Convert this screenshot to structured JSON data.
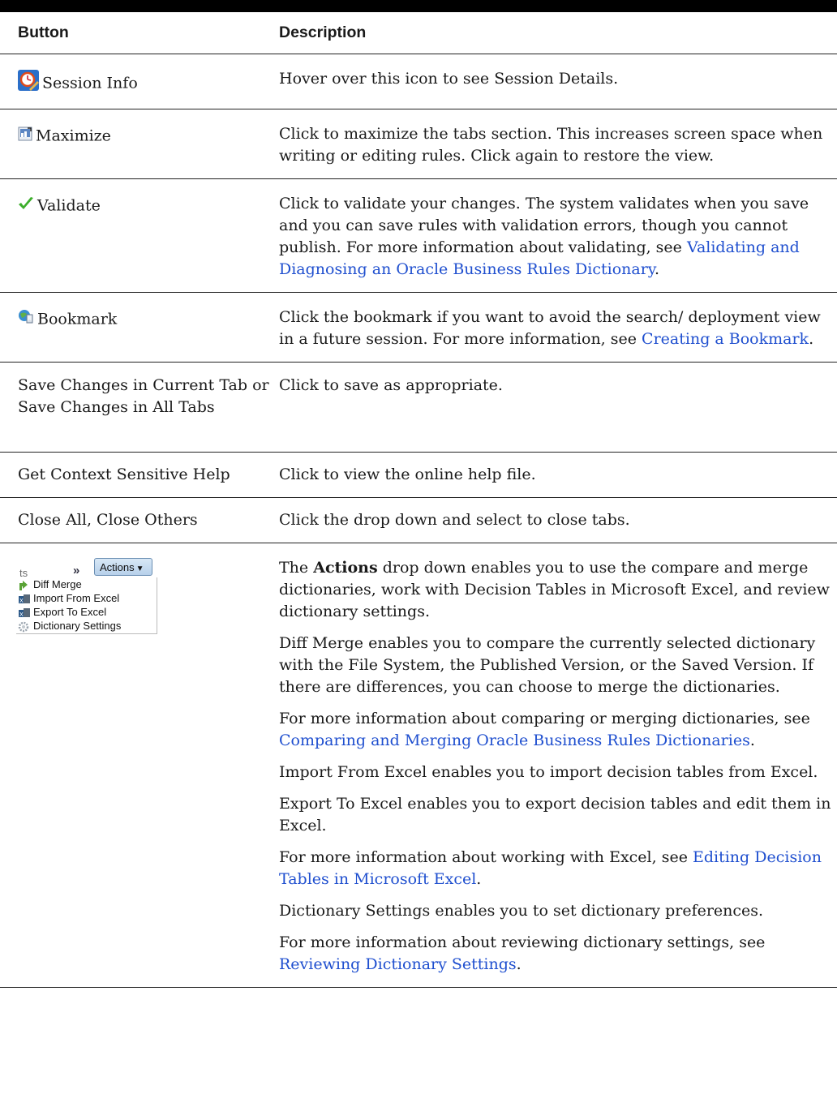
{
  "table": {
    "headers": {
      "button": "Button",
      "description": "Description"
    },
    "rows": {
      "session": {
        "button": "Session Info",
        "icon": "session-clock-icon",
        "desc": "Hover over this icon to see Session Details."
      },
      "maximize": {
        "button": "Maximize",
        "icon": "maximize-icon",
        "desc": "Click to maximize the tabs section. This increases screen space when writing or editing rules. Click again to restore the view."
      },
      "validate": {
        "button": "Validate",
        "icon": "checkmark-icon",
        "desc_pre": "Click to validate your changes. The system validates when you save and you can save rules with validation errors, though you cannot publish. For more information about validating, see ",
        "desc_link": "Validating and Diagnosing an Oracle Business Rules Dictionary",
        "desc_post": "."
      },
      "bookmark": {
        "button": "Bookmark",
        "icon": "bookmark-icon",
        "desc_pre": "Click the bookmark if you want to avoid the search/ deployment view in a future session. For more information, see ",
        "desc_link": "Creating a Bookmark",
        "desc_post": "."
      },
      "save": {
        "button": "Save Changes in Current Tab or Save Changes in All Tabs",
        "desc": "Click to save as appropriate."
      },
      "help": {
        "button": "Get Context Sensitive Help",
        "desc": "Click to view the online help file."
      },
      "close": {
        "button": "Close All, Close Others",
        "desc": "Click the drop down and select to close tabs."
      },
      "actions": {
        "menu": {
          "tab_fragment": "ts",
          "chevron": "»",
          "button_label": "Actions",
          "items": [
            "Diff Merge",
            "Import From Excel",
            "Export To Excel",
            "Dictionary Settings"
          ]
        },
        "p1_pre": "The ",
        "p1_bold": "Actions",
        "p1_post": " drop down enables you to use the compare and merge dictionaries, work with Decision Tables in Microsoft Excel, and review dictionary settings.",
        "p2": "Diff Merge enables you to compare the currently selected dictionary with the File System, the Published Version, or the Saved Version. If there are differences, you can choose to merge the dictionaries.",
        "p3_pre": "For more information about comparing or merging dictionaries, see ",
        "p3_link": "Comparing and Merging Oracle Business Rules Dictionaries",
        "p3_post": ".",
        "p4": "Import From Excel enables you to import decision tables from Excel.",
        "p5": "Export To Excel enables you to export decision tables and edit them in Excel.",
        "p6_pre": "For more information about working with Excel, see ",
        "p6_link": "Editing Decision Tables in Microsoft Excel",
        "p6_post": ".",
        "p7": "Dictionary Settings enables you to set dictionary preferences.",
        "p8_pre": "For more information about reviewing dictionary settings, see ",
        "p8_link": "Reviewing Dictionary Settings",
        "p8_post": "."
      }
    }
  },
  "colors": {
    "link": "#1f4fcf",
    "rule": "#222222",
    "topbar": "#000000"
  }
}
